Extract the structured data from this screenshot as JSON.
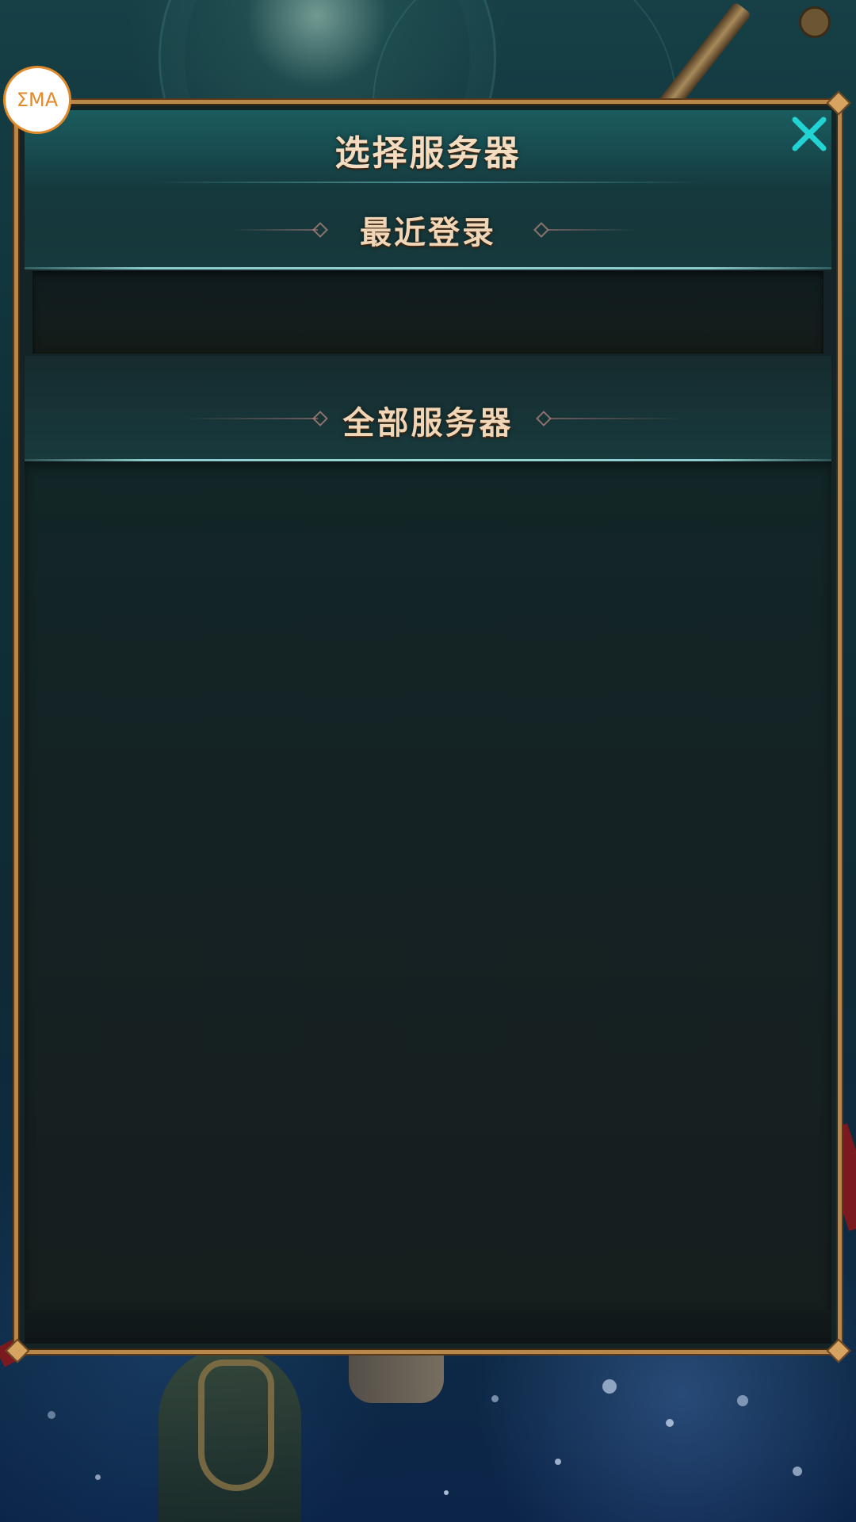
{
  "logo": {
    "text": "ΣMA"
  },
  "dialog": {
    "title": "选择服务器",
    "close_icon": "close-icon",
    "sections": {
      "recent": {
        "label": "最近登录",
        "items": []
      },
      "all": {
        "label": "全部服务器",
        "items": []
      }
    },
    "footer_text": ""
  },
  "colors": {
    "title_text": "#f3dcc0",
    "frame_gold": "#b8874a",
    "close_cyan": "#22d3d3",
    "header_teal": "#1b5c5e",
    "logo_orange": "#e08a2a"
  }
}
